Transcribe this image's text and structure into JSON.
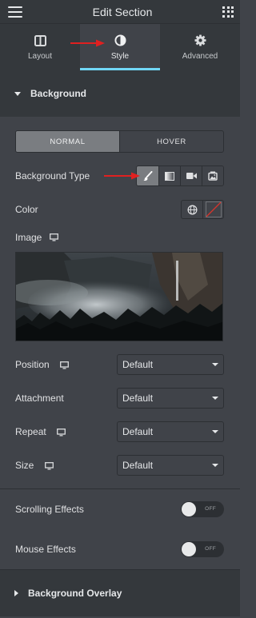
{
  "header": {
    "title": "Edit Section",
    "menu_icon": "hamburger-icon",
    "apps_icon": "grid-icon"
  },
  "tabs": [
    {
      "label": "Layout",
      "icon": "columns-icon",
      "active": false
    },
    {
      "label": "Style",
      "icon": "half-circle-icon",
      "active": true
    },
    {
      "label": "Advanced",
      "icon": "gear-icon",
      "active": false
    }
  ],
  "background_section": {
    "title": "Background",
    "state_toggle": {
      "normal": "NORMAL",
      "hover": "HOVER",
      "active": "normal"
    },
    "background_type": {
      "label": "Background Type",
      "options": [
        "brush-icon",
        "gradient-icon",
        "video-icon",
        "slideshow-icon"
      ],
      "active": "brush-icon"
    },
    "color": {
      "label": "Color"
    },
    "image": {
      "label": "Image"
    },
    "position": {
      "label": "Position",
      "value": "Default"
    },
    "attachment": {
      "label": "Attachment",
      "value": "Default"
    },
    "repeat": {
      "label": "Repeat",
      "value": "Default"
    },
    "size": {
      "label": "Size",
      "value": "Default"
    }
  },
  "scrolling_effects": {
    "label": "Scrolling Effects",
    "state": "OFF"
  },
  "mouse_effects": {
    "label": "Mouse Effects",
    "state": "OFF"
  },
  "overlay_section": {
    "title": "Background Overlay"
  },
  "colors": {
    "accent": "#71d7f7",
    "panel": "#404349",
    "header": "#34383c",
    "annotation_arrow": "#e02020"
  }
}
